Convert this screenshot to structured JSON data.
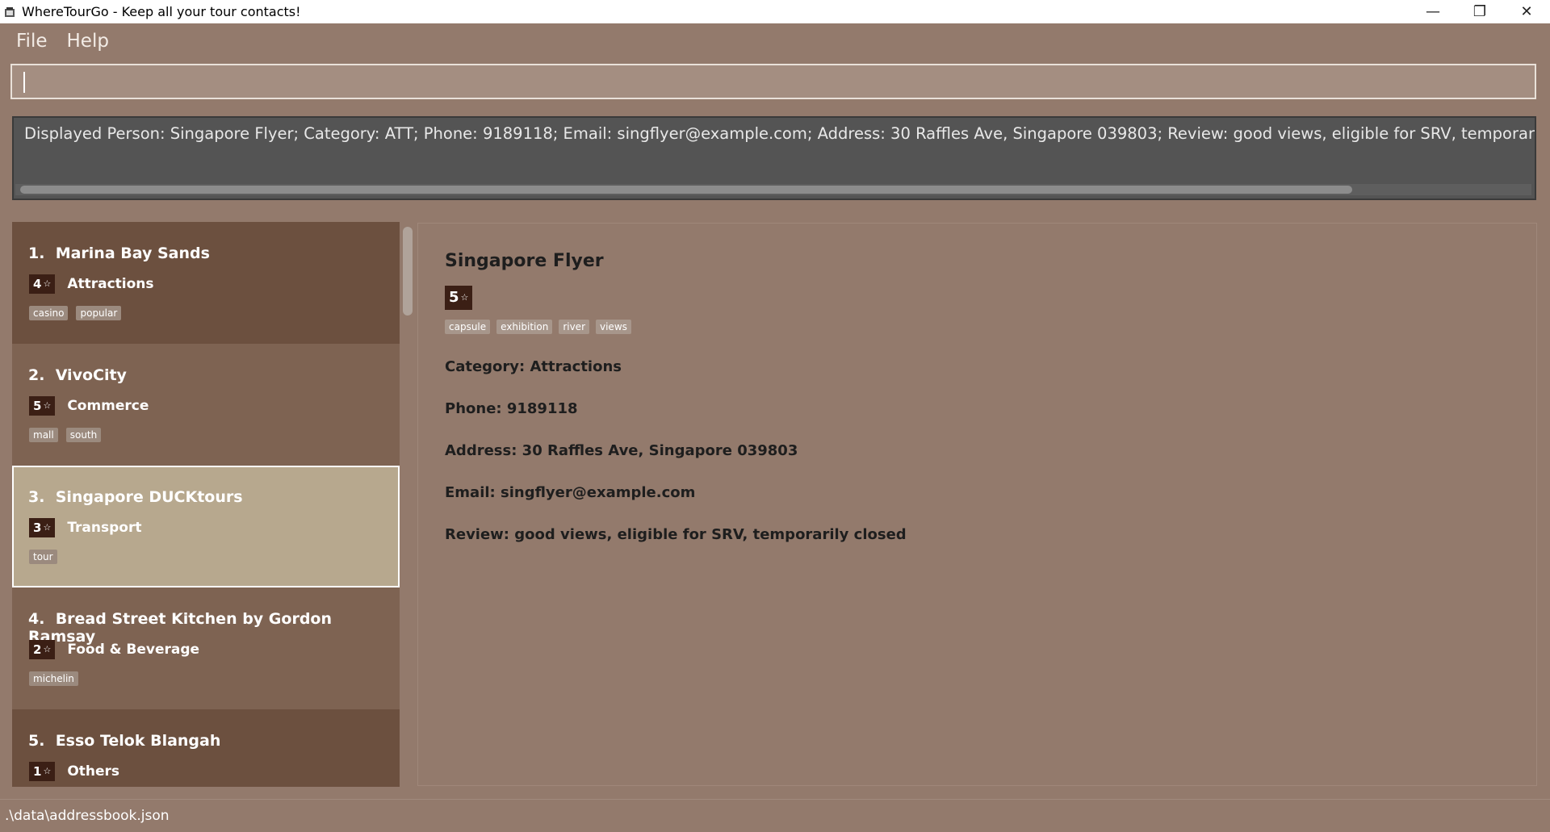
{
  "window": {
    "title": "WhereTourGo - Keep all your tour contacts!",
    "minimize": "—",
    "maximize": "❐",
    "close": "✕"
  },
  "menu": {
    "file": "File",
    "help": "Help"
  },
  "command": {
    "value": "",
    "placeholder": ""
  },
  "result": {
    "text": "Displayed Person: Singapore Flyer; Category: ATT; Phone: 9189118; Email: singflyer@example.com; Address: 30 Raffles Ave, Singapore 039803; Review: good views, eligible for SRV, temporarily closed; Tags: [exhibition][cap"
  },
  "list": [
    {
      "index": "1.",
      "name": "Marina Bay Sands",
      "rating": "4",
      "category": "Attractions",
      "tags": [
        "casino",
        "popular"
      ]
    },
    {
      "index": "2.",
      "name": "VivoCity",
      "rating": "5",
      "category": "Commerce",
      "tags": [
        "mall",
        "south"
      ]
    },
    {
      "index": "3.",
      "name": "Singapore DUCKtours",
      "rating": "3",
      "category": "Transport",
      "tags": [
        "tour"
      ]
    },
    {
      "index": "4.",
      "name": "Bread Street Kitchen by Gordon Ramsay",
      "rating": "2",
      "category": "Food & Beverage",
      "tags": [
        "michelin"
      ]
    },
    {
      "index": "5.",
      "name": "Esso Telok Blangah",
      "rating": "1",
      "category": "Others",
      "tags": []
    }
  ],
  "detail": {
    "name": "Singapore Flyer",
    "rating": "5",
    "tags": [
      "capsule",
      "exhibition",
      "river",
      "views"
    ],
    "category": "Category: Attractions",
    "phone": "Phone: 9189118",
    "address": "Address: 30 Raffles Ave, Singapore 039803",
    "email": "Email: singflyer@example.com",
    "review": "Review: good views, eligible for SRV, temporarily closed"
  },
  "status": {
    "path": ".\\data\\addressbook.json"
  },
  "icons": {
    "star": "☆"
  }
}
